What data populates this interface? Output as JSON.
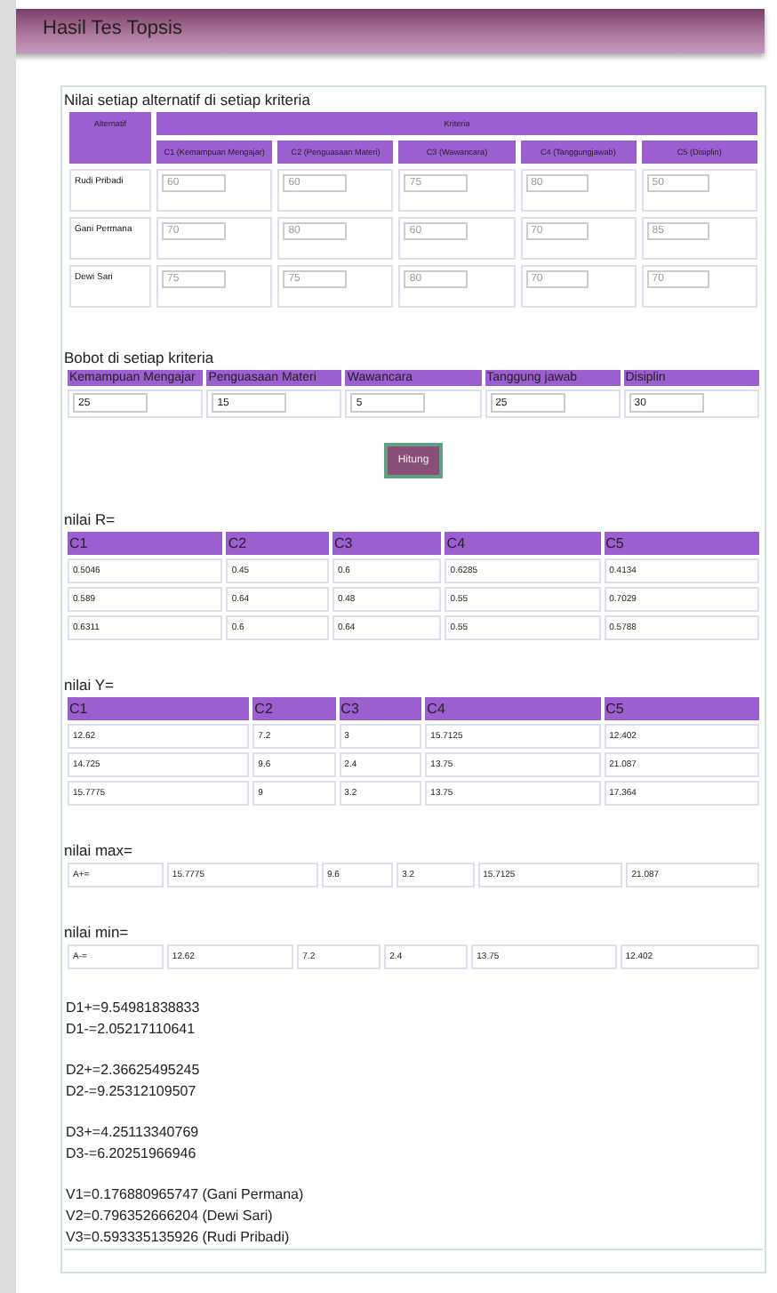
{
  "page_title": "Hasil Tes Topsis",
  "alternatives": {
    "caption": "Nilai setiap alternatif di setiap kriteria",
    "header_alt": "Alternatif",
    "header_group": "Kriteria",
    "columns": [
      "C1 (Kemampuan Mengajar)",
      "C2 (Penguasaan Materi)",
      "C3 (Wawancara)",
      "C4 (Tanggungjawab)",
      "C5 (Disiplin)"
    ],
    "rows": [
      {
        "name": "Rudi Pribadi",
        "values": [
          "60",
          "60",
          "75",
          "80",
          "50"
        ]
      },
      {
        "name": "Gani Permana",
        "values": [
          "70",
          "80",
          "60",
          "70",
          "85"
        ]
      },
      {
        "name": "Dewi Sari",
        "values": [
          "75",
          "75",
          "80",
          "70",
          "70"
        ]
      }
    ]
  },
  "weights": {
    "caption": "Bobot di setiap kriteria",
    "columns": [
      "Kemampuan Mengajar",
      "Penguasaan Materi",
      "Wawancara",
      "Tanggung jawab",
      "Disiplin"
    ],
    "values": [
      "25",
      "15",
      "5",
      "25",
      "30"
    ]
  },
  "calculate_button": "Hitung",
  "matrix_r": {
    "caption": "nilai R=",
    "columns": [
      "C1",
      "C2",
      "C3",
      "C4",
      "C5"
    ],
    "rows": [
      [
        "0.5046",
        "0.45",
        "0.6",
        "0.6285",
        "0.4134"
      ],
      [
        "0.589",
        "0.64",
        "0.48",
        "0.55",
        "0.7029"
      ],
      [
        "0.6311",
        "0.6",
        "0.64",
        "0.55",
        "0.5788"
      ]
    ]
  },
  "matrix_y": {
    "caption": "nilai Y=",
    "columns": [
      "C1",
      "C2",
      "C3",
      "C4",
      "C5"
    ],
    "rows": [
      [
        "12.62",
        "7.2",
        "3",
        "15.7125",
        "12.402"
      ],
      [
        "14.725",
        "9.6",
        "2.4",
        "13.75",
        "21.087"
      ],
      [
        "15.7775",
        "9",
        "3.2",
        "13.75",
        "17.364"
      ]
    ]
  },
  "max": {
    "caption": "nilai max=",
    "cells": [
      "A+=",
      "15.7775",
      "9.6",
      "3.2",
      "15.7125",
      "21.087"
    ]
  },
  "min": {
    "caption": "nilai min=",
    "cells": [
      "A-=",
      "12.62",
      "7.2",
      "2.4",
      "13.75",
      "12.402"
    ]
  },
  "results": [
    [
      "D1+=9.54981838833",
      "D1-=2.05217110641"
    ],
    [
      "D2+=2.36625495245",
      "D2-=9.25312109507"
    ],
    [
      "D3+=4.25113340769",
      "D3-=6.20251966946"
    ],
    [
      "V1=0.176880965747 (Gani Permana)",
      "V2=0.796352666204 (Dewi Sari)",
      "V3=0.593335135926 (Rudi Pribadi)"
    ]
  ]
}
